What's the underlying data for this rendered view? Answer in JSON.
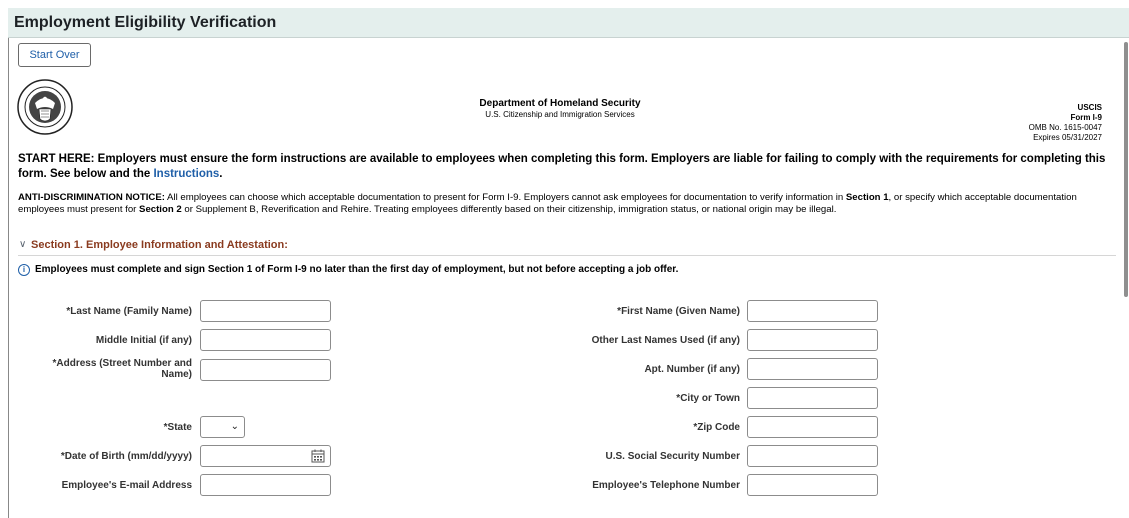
{
  "header": {
    "title": "Employment Eligibility Verification"
  },
  "toolbar": {
    "start_over_label": "Start Over"
  },
  "agency": {
    "department": "Department of Homeland Security",
    "subagency": "U.S. Citizenship and Immigration Services"
  },
  "form_id": {
    "agency": "USCIS",
    "form": "Form I-9",
    "omb": "OMB No. 1615-0047",
    "expires": "Expires 05/31/2027"
  },
  "start_here": {
    "text": "START HERE: Employers must ensure the form instructions are available to employees when completing this form. Employers are liable for failing to comply with the requirements for completing this form. See below and the ",
    "link": "Instructions",
    "suffix": "."
  },
  "anti_discrimination": {
    "label": "ANTI-DISCRIMINATION NOTICE:",
    "p1": " All employees can choose which acceptable documentation to present for Form I-9. Employers cannot ask employees for documentation to verify information in ",
    "s1": "Section 1",
    "p2": ", or specify which acceptable documentation employees must present for ",
    "s2": "Section 2",
    "p3": " or Supplement B, Reverification and Rehire. Treating employees differently based on their citizenship, immigration status, or national origin may be illegal."
  },
  "section1": {
    "title": "Section 1. Employee Information and Attestation:",
    "notice": "Employees must complete and sign Section 1 of Form I-9 no later than the first day of employment, but not before accepting a job offer."
  },
  "fields": {
    "last_name": {
      "label": "*Last Name (Family Name)",
      "value": ""
    },
    "first_name": {
      "label": "*First Name (Given Name)",
      "value": ""
    },
    "middle_initial": {
      "label": "Middle Initial (if any)",
      "value": ""
    },
    "other_last_names": {
      "label": "Other Last Names Used (if any)",
      "value": ""
    },
    "address_line1": "*Address (Street Number and",
    "address_line2": "Name)",
    "apt": {
      "label": "Apt. Number (if any)",
      "value": ""
    },
    "city": {
      "label": "*City or Town",
      "value": ""
    },
    "state": {
      "label": "*State",
      "value": ""
    },
    "zip": {
      "label": "*Zip Code",
      "value": ""
    },
    "dob": {
      "label": "*Date of Birth (mm/dd/yyyy)",
      "value": ""
    },
    "ssn": {
      "label": "U.S. Social Security Number",
      "value": ""
    },
    "email": {
      "label": "Employee's E-mail Address",
      "value": ""
    },
    "phone": {
      "label": "Employee's Telephone Number",
      "value": ""
    }
  },
  "icons": {
    "seal": "dhs-seal-icon",
    "info": "info-icon",
    "section_toggle": "chevron-down-icon",
    "calendar": "calendar-icon",
    "select_caret": "chevron-down-icon"
  },
  "colors": {
    "title_bar_bg": "#e4efed",
    "link": "#1f5fa8",
    "section_title": "#8a3b1f"
  }
}
